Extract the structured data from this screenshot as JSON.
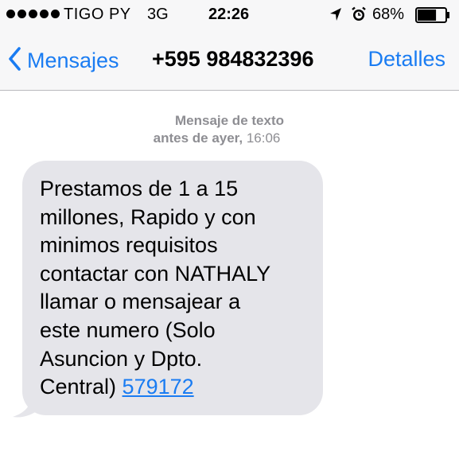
{
  "status_bar": {
    "carrier": "TIGO PY",
    "network": "3G",
    "time": "22:26",
    "battery_percent": "68%",
    "signal_dots": 5,
    "battery_level": 0.68,
    "icons": [
      "signal-dots-icon",
      "location-arrow-icon",
      "alarm-clock-icon",
      "battery-icon"
    ]
  },
  "nav": {
    "back_label": "Mensajes",
    "title": "+595 984832396",
    "details_label": "Detalles"
  },
  "conversation": {
    "timestamp_label": "Mensaje de texto",
    "timestamp_day": "antes de ayer,",
    "timestamp_time": "16:06",
    "message": {
      "lines": [
        "Prestamos de 1 a 15",
        "millones, Rapido y con",
        "minimos requisitos",
        "contactar con NATHALY",
        "llamar o mensajear a",
        "este numero (Solo",
        "Asuncion y Dpto.",
        "Central)"
      ],
      "link_number": "579172"
    }
  },
  "colors": {
    "accent": "#1a7cf2",
    "bubble": "#e5e5ea",
    "header_bg": "#f7f7f8",
    "meta_text": "#8e8e93"
  }
}
